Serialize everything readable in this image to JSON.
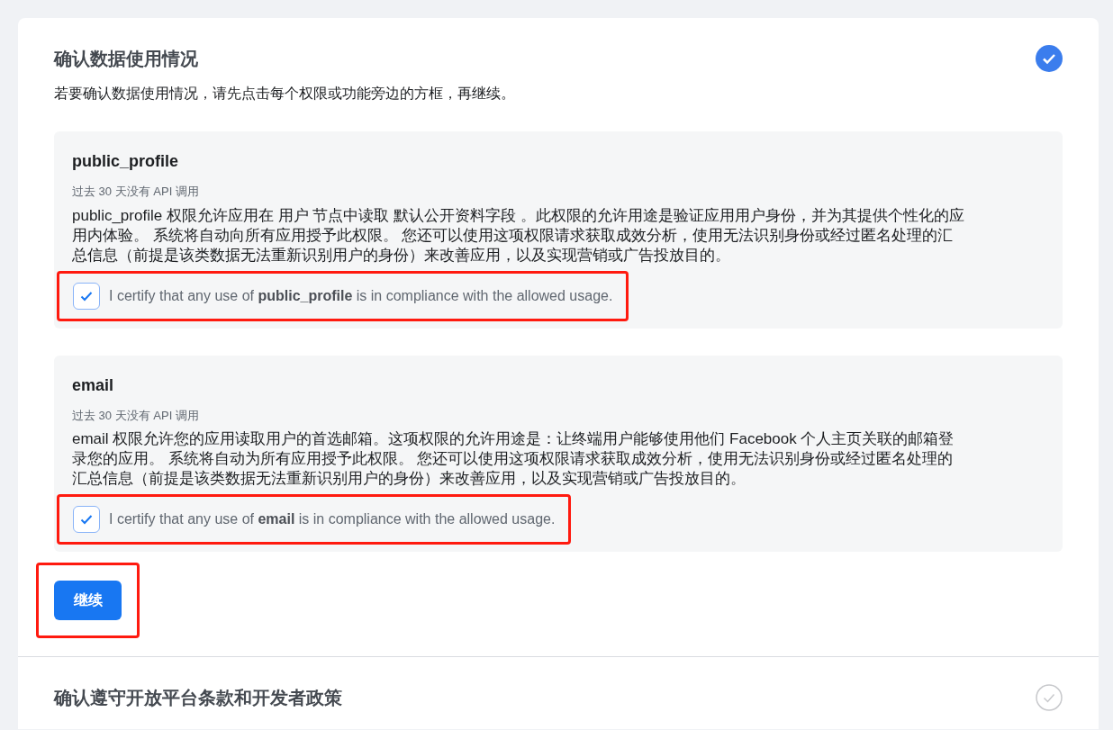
{
  "sections": [
    {
      "title": "确认数据使用情况",
      "completed": true,
      "description": "若要确认数据使用情况，请先点击每个权限或功能旁边的方框，再继续。",
      "permissions": [
        {
          "name": "public_profile",
          "note": "过去 30 天没有 API 调用",
          "description": "public_profile 权限允许应用在 用户 节点中读取 默认公开资料字段 。此权限的允许用途是验证应用用户身份，并为其提供个性化的应用内体验。 系统将自动向所有应用授予此权限。 您还可以使用这项权限请求获取成效分析，使用无法识别身份或经过匿名处理的汇总信息（前提是该类数据无法重新识别用户的身份）来改善应用，以及实现营销或广告投放目的。",
          "certify": "I certify that any use of **public_profile** is in compliance with the allowed usage.",
          "checked": true,
          "highlighted": true
        },
        {
          "name": "email",
          "note": "过去 30 天没有 API 调用",
          "description": "email 权限允许您的应用读取用户的首选邮箱。这项权限的允许用途是：让终端用户能够使用他们 Facebook 个人主页关联的邮箱登录您的应用。 系统将自动为所有应用授予此权限。 您还可以使用这项权限请求获取成效分析，使用无法识别身份或经过匿名处理的汇总信息（前提是该类数据无法重新识别用户的身份）来改善应用，以及实现营销或广告投放目的。",
          "certify": "I certify that any use of **email** is in compliance with the allowed usage.",
          "checked": true,
          "highlighted": true
        }
      ],
      "button": {
        "label": "继续",
        "highlighted": true
      }
    },
    {
      "title": "确认遵守开放平台条款和开发者政策",
      "completed": false
    }
  ]
}
